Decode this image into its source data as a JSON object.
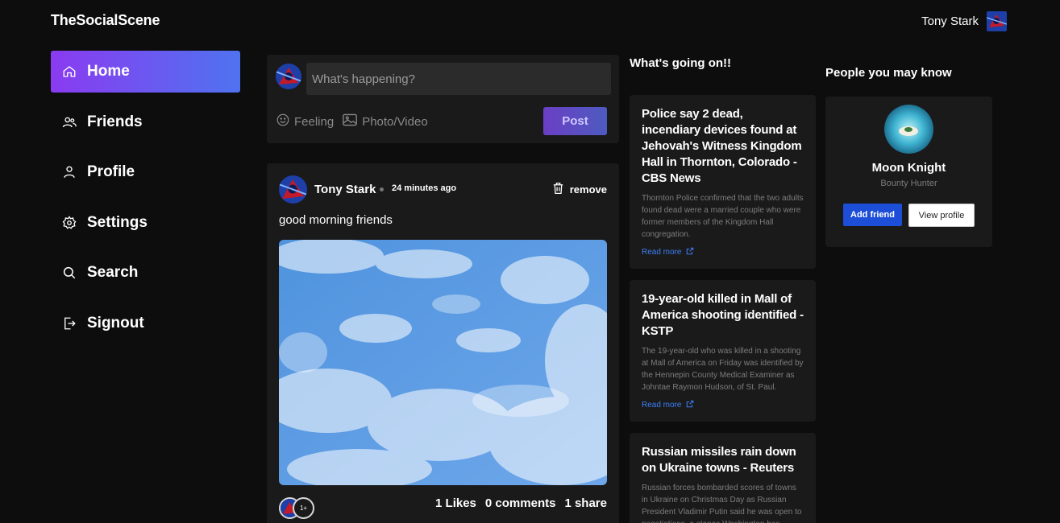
{
  "header": {
    "brand": "TheSocialScene",
    "user_name": "Tony Stark",
    "user_avatar_icon": "spiderman-avatar"
  },
  "sidebar": {
    "items": [
      {
        "label": "Home",
        "icon": "home-icon",
        "active": true
      },
      {
        "label": "Friends",
        "icon": "friends-icon",
        "active": false
      },
      {
        "label": "Profile",
        "icon": "profile-icon",
        "active": false
      },
      {
        "label": "Settings",
        "icon": "gear-icon",
        "active": false
      },
      {
        "label": "Search",
        "icon": "search-icon",
        "active": false
      },
      {
        "label": "Signout",
        "icon": "signout-icon",
        "active": false
      }
    ],
    "active_gradient": [
      "#8a3bf0",
      "#4f73f0"
    ]
  },
  "composer": {
    "placeholder": "What's happening?",
    "feeling_label": "Feeling",
    "photo_label": "Photo/Video",
    "post_label": "Post"
  },
  "post": {
    "author": "Tony Stark",
    "time": "24 minutes ago",
    "remove_label": "remove",
    "text": "good morning friends",
    "likers_more": "1+",
    "likes": "1 Likes",
    "comments": "0 comments",
    "shares": "1 share"
  },
  "news": {
    "title": "What's going on!!",
    "read_more": "Read more",
    "items": [
      {
        "headline": "Police say 2 dead, incendiary devices found at Jehovah's Witness Kingdom Hall in Thornton, Colorado - CBS News",
        "description": "Thornton Police confirmed that the two adults found dead were a married couple who were former members of the Kingdom Hall congregation."
      },
      {
        "headline": "19-year-old killed in Mall of America shooting identified - KSTP",
        "description": "The 19-year-old who was killed in a shooting at Mall of America on Friday was identified by the Hennepin County Medical Examiner as Johntae Raymon Hudson, of St. Paul."
      },
      {
        "headline": "Russian missiles rain down on Ukraine towns - Reuters",
        "description": "Russian forces bombarded scores of towns in Ukraine on Christmas Day as Russian President Vladimir Putin said he was open to negotiations, a stance Washington has"
      }
    ]
  },
  "people": {
    "title": "People you may know",
    "suggestion": {
      "name": "Moon Knight",
      "role": "Bounty Hunter",
      "add_label": "Add friend",
      "view_label": "View profile"
    }
  },
  "colors": {
    "background": "#0d0d0e",
    "card": "#1a1a1b",
    "accent_blue": "#1d4ed8",
    "link_blue": "#3d7ff5"
  }
}
